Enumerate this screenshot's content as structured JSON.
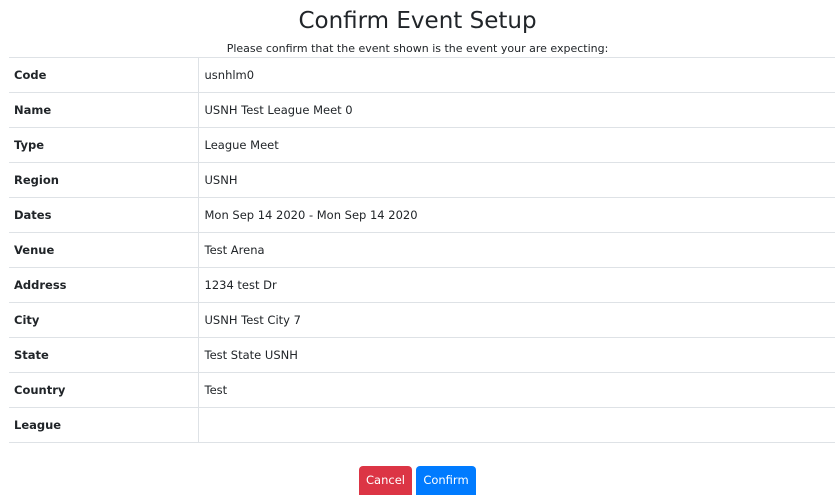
{
  "header": {
    "title": "Confirm Event Setup",
    "subtitle": "Please confirm that the event shown is the event your are expecting:"
  },
  "details": {
    "rows": [
      {
        "label": "Code",
        "value": "usnhlm0"
      },
      {
        "label": "Name",
        "value": "USNH Test League Meet 0"
      },
      {
        "label": "Type",
        "value": "League Meet"
      },
      {
        "label": "Region",
        "value": "USNH"
      },
      {
        "label": "Dates",
        "value": "Mon Sep 14 2020 - Mon Sep 14 2020"
      },
      {
        "label": "Venue",
        "value": "Test Arena"
      },
      {
        "label": "Address",
        "value": "1234 test Dr"
      },
      {
        "label": "City",
        "value": "USNH Test City 7"
      },
      {
        "label": "State",
        "value": "Test State USNH"
      },
      {
        "label": "Country",
        "value": "Test"
      },
      {
        "label": "League",
        "value": ""
      }
    ]
  },
  "actions": {
    "cancel_label": "Cancel",
    "confirm_label": "Confirm"
  },
  "colors": {
    "cancel": "#dc3545",
    "confirm": "#007bff",
    "border": "#dee2e6"
  }
}
